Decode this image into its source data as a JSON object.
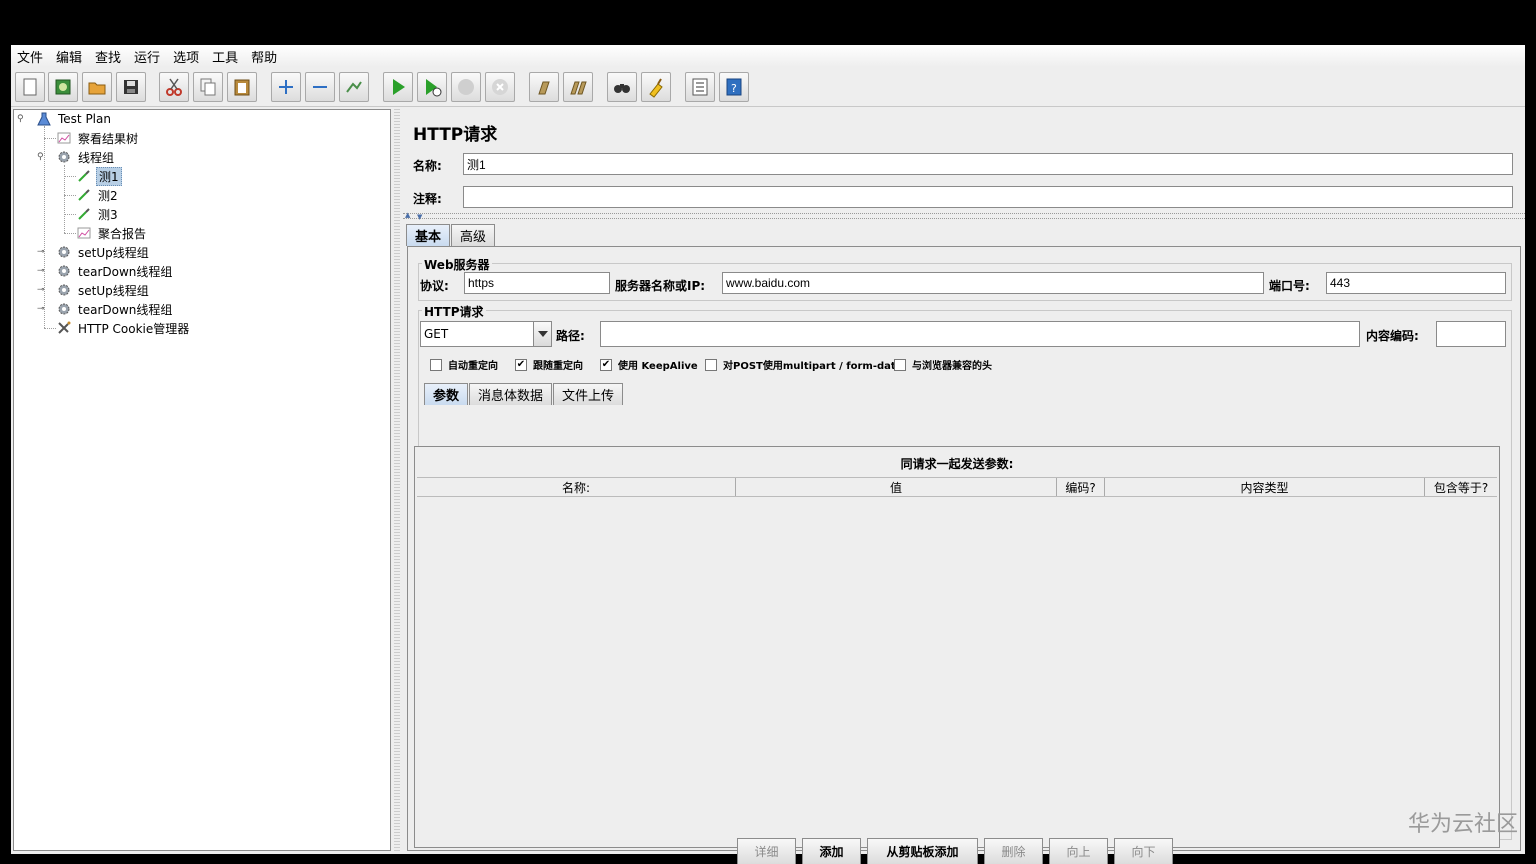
{
  "menu": [
    "文件",
    "编辑",
    "查找",
    "运行",
    "选项",
    "工具",
    "帮助"
  ],
  "toolbar": {
    "icons": [
      "new-icon",
      "templates-icon",
      "open-icon",
      "save-icon",
      "cut-icon",
      "copy-icon",
      "paste-icon",
      "expand-icon",
      "collapse-icon",
      "toggle-icon",
      "start-icon",
      "start-no-pause-icon",
      "stop-icon",
      "shutdown-icon",
      "clear-icon",
      "clear-all-icon",
      "search-icon",
      "reset-search-icon",
      "function-helper-icon",
      "help-icon"
    ]
  },
  "tree": {
    "root": "Test Plan",
    "items": [
      {
        "label": "察看结果树",
        "icon": "listener-icon"
      },
      {
        "label": "线程组",
        "icon": "thread-group-icon"
      },
      {
        "label": "测1",
        "icon": "sampler-icon"
      },
      {
        "label": "测2",
        "icon": "sampler-icon"
      },
      {
        "label": "测3",
        "icon": "sampler-icon"
      },
      {
        "label": "聚合报告",
        "icon": "listener-icon"
      },
      {
        "label": "setUp线程组",
        "icon": "thread-group-icon"
      },
      {
        "label": "tearDown线程组",
        "icon": "thread-group-icon"
      },
      {
        "label": "setUp线程组",
        "icon": "thread-group-icon"
      },
      {
        "label": "tearDown线程组",
        "icon": "thread-group-icon"
      },
      {
        "label": "HTTP Cookie管理器",
        "icon": "config-icon"
      }
    ]
  },
  "panel": {
    "title": "HTTP请求",
    "name_label": "名称:",
    "name_value": "测1",
    "comment_label": "注释:",
    "comment_value": "",
    "tabs": [
      "基本",
      "高级"
    ],
    "web_server": {
      "title": "Web服务器",
      "protocol_label": "协议:",
      "protocol_value": "https",
      "server_label": "服务器名称或IP:",
      "server_value": "www.baidu.com",
      "port_label": "端口号:",
      "port_value": "443"
    },
    "http_request": {
      "title": "HTTP请求",
      "method": "GET",
      "path_label": "路径:",
      "path_value": "",
      "encoding_label": "内容编码:",
      "encoding_value": ""
    },
    "checkboxes": [
      {
        "label": "自动重定向",
        "checked": false
      },
      {
        "label": "跟随重定向",
        "checked": true
      },
      {
        "label": "使用 KeepAlive",
        "checked": true
      },
      {
        "label": "对POST使用multipart / form-data",
        "checked": false
      },
      {
        "label": "与浏览器兼容的头",
        "checked": false
      }
    ],
    "sub_tabs": [
      "参数",
      "消息体数据",
      "文件上传"
    ],
    "params": {
      "caption": "同请求一起发送参数:",
      "columns": [
        "名称:",
        "值",
        "编码?",
        "内容类型",
        "包含等于?"
      ]
    },
    "buttons": [
      {
        "label": "详细",
        "enabled": false
      },
      {
        "label": "添加",
        "enabled": true
      },
      {
        "label": "从剪贴板添加",
        "enabled": true
      },
      {
        "label": "删除",
        "enabled": false
      },
      {
        "label": "向上",
        "enabled": false
      },
      {
        "label": "向下",
        "enabled": false
      }
    ]
  },
  "watermark": "华为云社区",
  "colors": {
    "selection": "#b8cfe5",
    "accent": "#4a6ea8"
  }
}
